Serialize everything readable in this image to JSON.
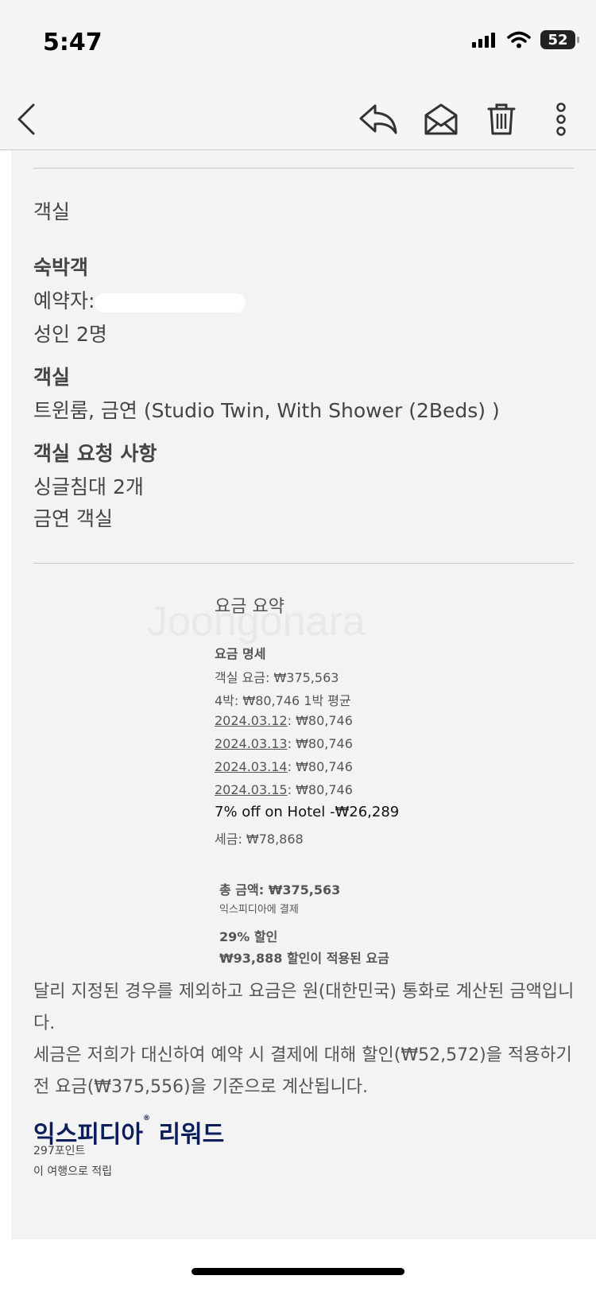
{
  "status_bar": {
    "time": "5:47",
    "battery": "52"
  },
  "toolbar": {
    "back_icon": "chevron-left-icon",
    "reply_icon": "reply-icon",
    "mark_unread_icon": "envelope-open-icon",
    "delete_icon": "trash-icon",
    "more_icon": "more-vertical-icon"
  },
  "room_section": {
    "heading": "객실",
    "guest_title": "숙박객",
    "booker_label": "예약자:",
    "guests": "성인 2명",
    "room_title": "객실",
    "room_name": "트윈룸, 금연 (Studio Twin, With Shower (2Beds) )",
    "requests_title": "객실 요청 사항",
    "requests": [
      "싱글침대 2개",
      "금연 객실"
    ]
  },
  "price_summary": {
    "heading": "요금 요약",
    "details_title": "요금 명세",
    "room_charge": "객실 요금: ₩375,563",
    "nights_avg": "4박: ₩80,746 1박 평균",
    "nights": [
      {
        "date": "2024.03.12",
        "amount": ": ₩80,746"
      },
      {
        "date": "2024.03.13",
        "amount": ": ₩80,746"
      },
      {
        "date": "2024.03.14",
        "amount": ": ₩80,746"
      },
      {
        "date": "2024.03.15",
        "amount": ": ₩80,746"
      }
    ],
    "discount": "7% off on Hotel -₩26,289",
    "tax": "세금: ₩78,868",
    "total": "총 금액: ₩375,563",
    "paid_to": "익스피디아에 결제",
    "discount_pct": "29% 할인",
    "discount_note": "₩93,888 할인이 적용된 요금"
  },
  "notes": [
    "달리 지정된 경우를 제외하고 요금은 원(대한민국) 통화로 계산된 금액입니다.",
    "세금은 저희가 대신하여 예약 시 결제에 대해 할인(₩52,572)을 적용하기 전 요금(₩375,556)을 기준으로 계산됩니다."
  ],
  "rewards": {
    "brand": "익스피디아",
    "brand_suffix": "리워드",
    "points": "297포인트",
    "earned": "이 여행으로 적립"
  },
  "watermark": "Joongonara"
}
